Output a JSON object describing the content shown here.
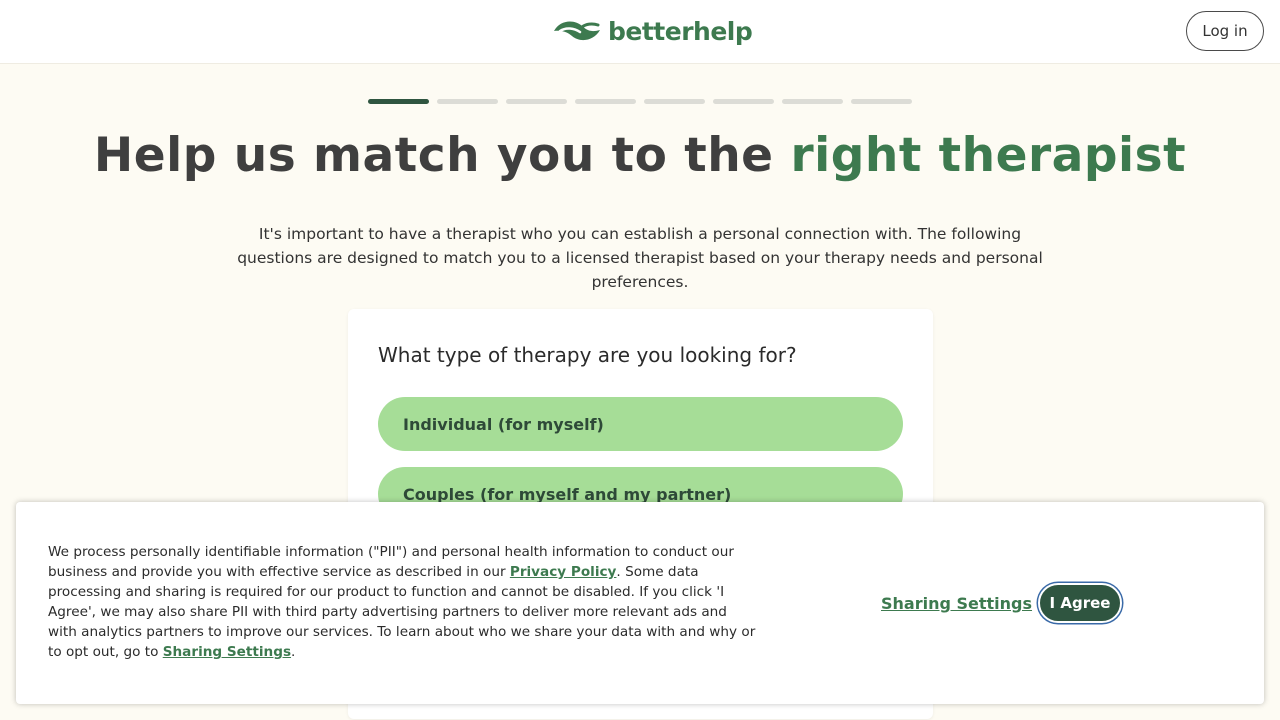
{
  "header": {
    "logo_text": "betterhelp",
    "logo_icon": "leaf-icon",
    "login_label": "Log in"
  },
  "progress": {
    "current_step": 1,
    "total_steps": 8
  },
  "main": {
    "title_part1": "Help us match you to the ",
    "title_accent": "right therapist",
    "intro": "It's important to have a therapist who you can establish a personal connection with. The following questions are designed to match you to a licensed therapist based on your therapy needs and personal preferences.",
    "question": "What type of therapy are you looking for?",
    "options": [
      {
        "label": "Individual (for myself)"
      },
      {
        "label": "Couples (for myself and my partner)"
      }
    ]
  },
  "cookie_banner": {
    "text_1": "We process personally identifiable information (\"PII\") and personal health information to conduct our business and provide you with effective service as described in our ",
    "privacy_link": "Privacy Policy",
    "text_2": ". Some data processing and sharing is required for our product to function and cannot be disabled. If you click 'I Agree', we may also share PII with third party advertising partners to deliver more relevant ads and with analytics partners to improve our services. To learn about who we share your data with and why or to opt out, go to ",
    "sharing_inline_link": "Sharing Settings",
    "text_3": ".",
    "sharing_button": "Sharing Settings",
    "agree_button": "I Agree"
  },
  "colors": {
    "brand_green": "#3d7a4f",
    "dark_green": "#2f5540",
    "option_green": "#a6dd97",
    "background": "#fdfbf3"
  }
}
